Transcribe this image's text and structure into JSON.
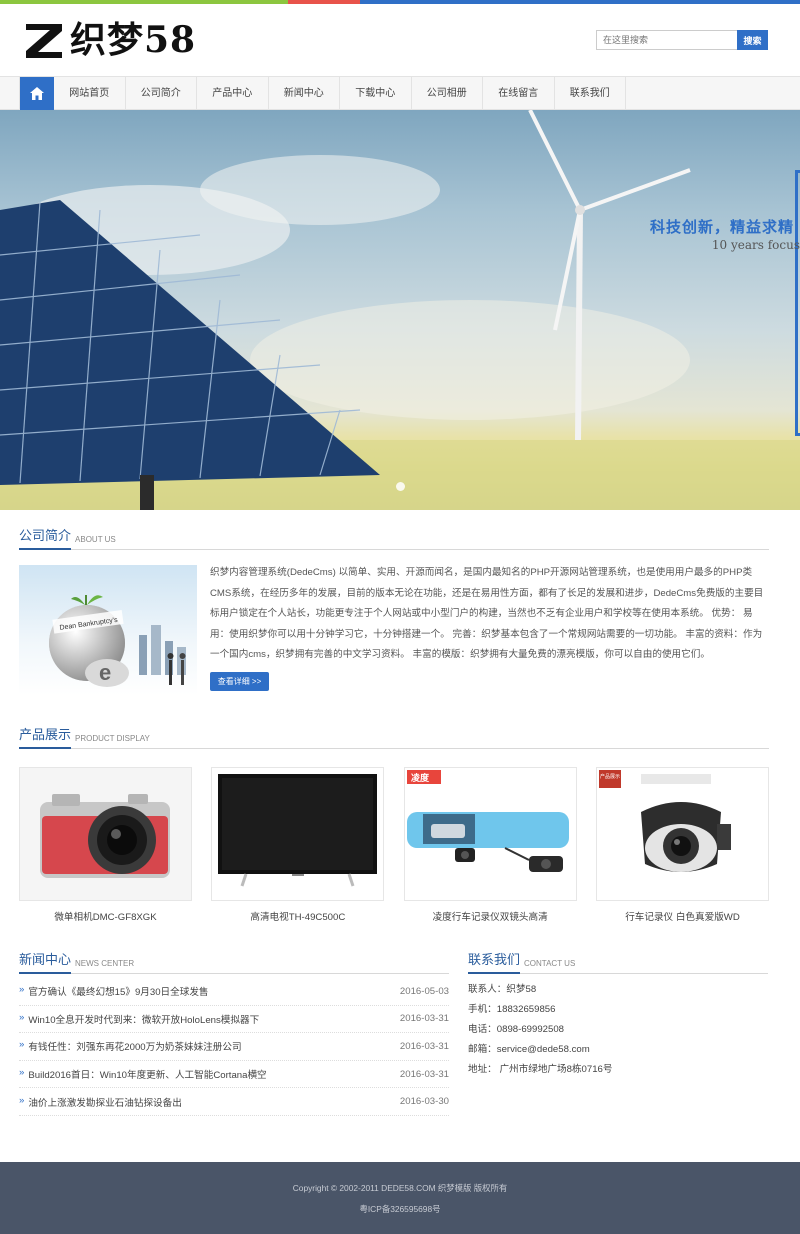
{
  "brand": {
    "logo_letter": "Z",
    "logo_text": "织梦58",
    "colors": {
      "primary": "#2f6fc7",
      "topbar": [
        "#8cc63f",
        "#e8534a",
        "#2f6fc7"
      ],
      "footer_bg": "#4a5568"
    }
  },
  "search": {
    "placeholder": "在这里搜索",
    "button_label": "搜索"
  },
  "nav": {
    "home_icon": "home-icon",
    "items": [
      "网站首页",
      "公司简介",
      "产品中心",
      "新闻中心",
      "下载中心",
      "公司相册",
      "在线留言",
      "联系我们"
    ]
  },
  "banner": {
    "headline": "科技创新，精益求精",
    "subline": "10 years focus"
  },
  "about": {
    "title_cn": "公司简介",
    "title_en": "ABOUT US",
    "body": "织梦内容管理系统(DedeCms) 以简单、实用、开源而闻名，是国内最知名的PHP开源网站管理系统，也是使用用户最多的PHP类CMS系统，在经历多年的发展，目前的版本无论在功能，还是在易用性方面，都有了长足的发展和进步，DedeCms免费版的主要目标用户锁定在个人站长，功能更专注于个人网站或中小型门户的构建，当然也不乏有企业用户和学校等在使用本系统。 优势： 易用：使用织梦你可以用十分钟学习它，十分钟搭建一个。 完善：织梦基本包含了一个常规网站需要的一切功能。 丰富的资料：作为一个国内cms，织梦拥有完善的中文学习资料。 丰富的模版：织梦拥有大量免费的漂亮模版，你可以自由的使用它们。",
    "button_label": "查看详细 >>",
    "image_label": "Dean Bankruptcy's"
  },
  "products": {
    "title_cn": "产品展示",
    "title_en": "PRODUCT DISPLAY",
    "items": [
      {
        "name": "微单相机DMC-GF8XGK"
      },
      {
        "name": "高清电视TH-49C500C"
      },
      {
        "name": "凌度行车记录仪双镜头高清",
        "badge": "凌度"
      },
      {
        "name": "行车记录仪 白色真爱版WD",
        "badge": "产品展示"
      }
    ]
  },
  "news": {
    "title_cn": "新闻中心",
    "title_en": "NEWS CENTER",
    "items": [
      {
        "title": "官方确认《最终幻想15》9月30日全球发售",
        "date": "2016-05-03"
      },
      {
        "title": "Win10全息开发时代到来：微软开放HoloLens模拟器下",
        "date": "2016-03-31"
      },
      {
        "title": "有钱任性：刘强东再花2000万为奶茶妹妹注册公司",
        "date": "2016-03-31"
      },
      {
        "title": "Build2016首日：Win10年度更新、人工智能Cortana横空",
        "date": "2016-03-31"
      },
      {
        "title": "油价上涨激发勘探业石油钻探设备出",
        "date": "2016-03-30"
      }
    ]
  },
  "contact": {
    "title_cn": "联系我们",
    "title_en": "CONTACT US",
    "lines": [
      "联系人：织梦58",
      "手机：18832659856",
      "电话：0898-69992508",
      "邮箱：service@dede58.com",
      "地址： 广州市绿地广场8栋0716号"
    ]
  },
  "footer": {
    "copyright": "Copyright © 2002-2011 DEDE58.COM 织梦模版 版权所有",
    "icp": "粤ICP备326595698号"
  }
}
